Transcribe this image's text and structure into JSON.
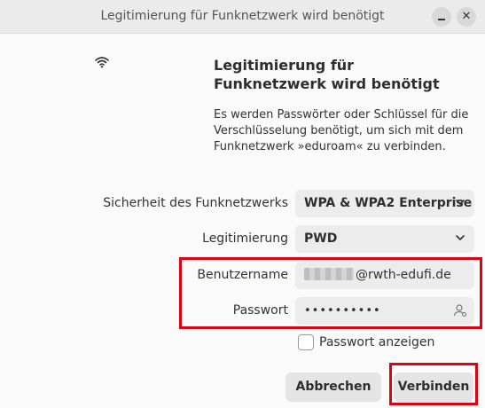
{
  "window": {
    "title": "Legitimierung für Funknetzwerk wird benötigt",
    "minimize_glyph": "",
    "close_glyph": "✕"
  },
  "dialog": {
    "heading": "Legitimierung für Funknetzwerk wird benötigt",
    "description": "Es werden Passwörter oder Schlüssel für die Verschlüsselung benötigt, um sich mit dem Funknetzwerk »eduroam« zu verbinden.",
    "icon": "wifi-icon"
  },
  "form": {
    "security": {
      "label": "Sicherheit des Funknetzwerks",
      "value": "WPA & WPA2 Enterprise"
    },
    "authentication": {
      "label": "Legitimierung",
      "value": "PWD"
    },
    "username": {
      "label": "Benutzername",
      "value_visible_suffix": "@rwth-edufi.de"
    },
    "password": {
      "label": "Passwort",
      "value": "••••••••••"
    },
    "show_password": {
      "label": "Passwort anzeigen",
      "checked": false
    }
  },
  "buttons": {
    "cancel": "Abbrechen",
    "connect": "Verbinden"
  },
  "colors": {
    "highlight": "#e3000f",
    "field_bg": "#ececec",
    "titlebar_bg": "#ebebeb"
  }
}
